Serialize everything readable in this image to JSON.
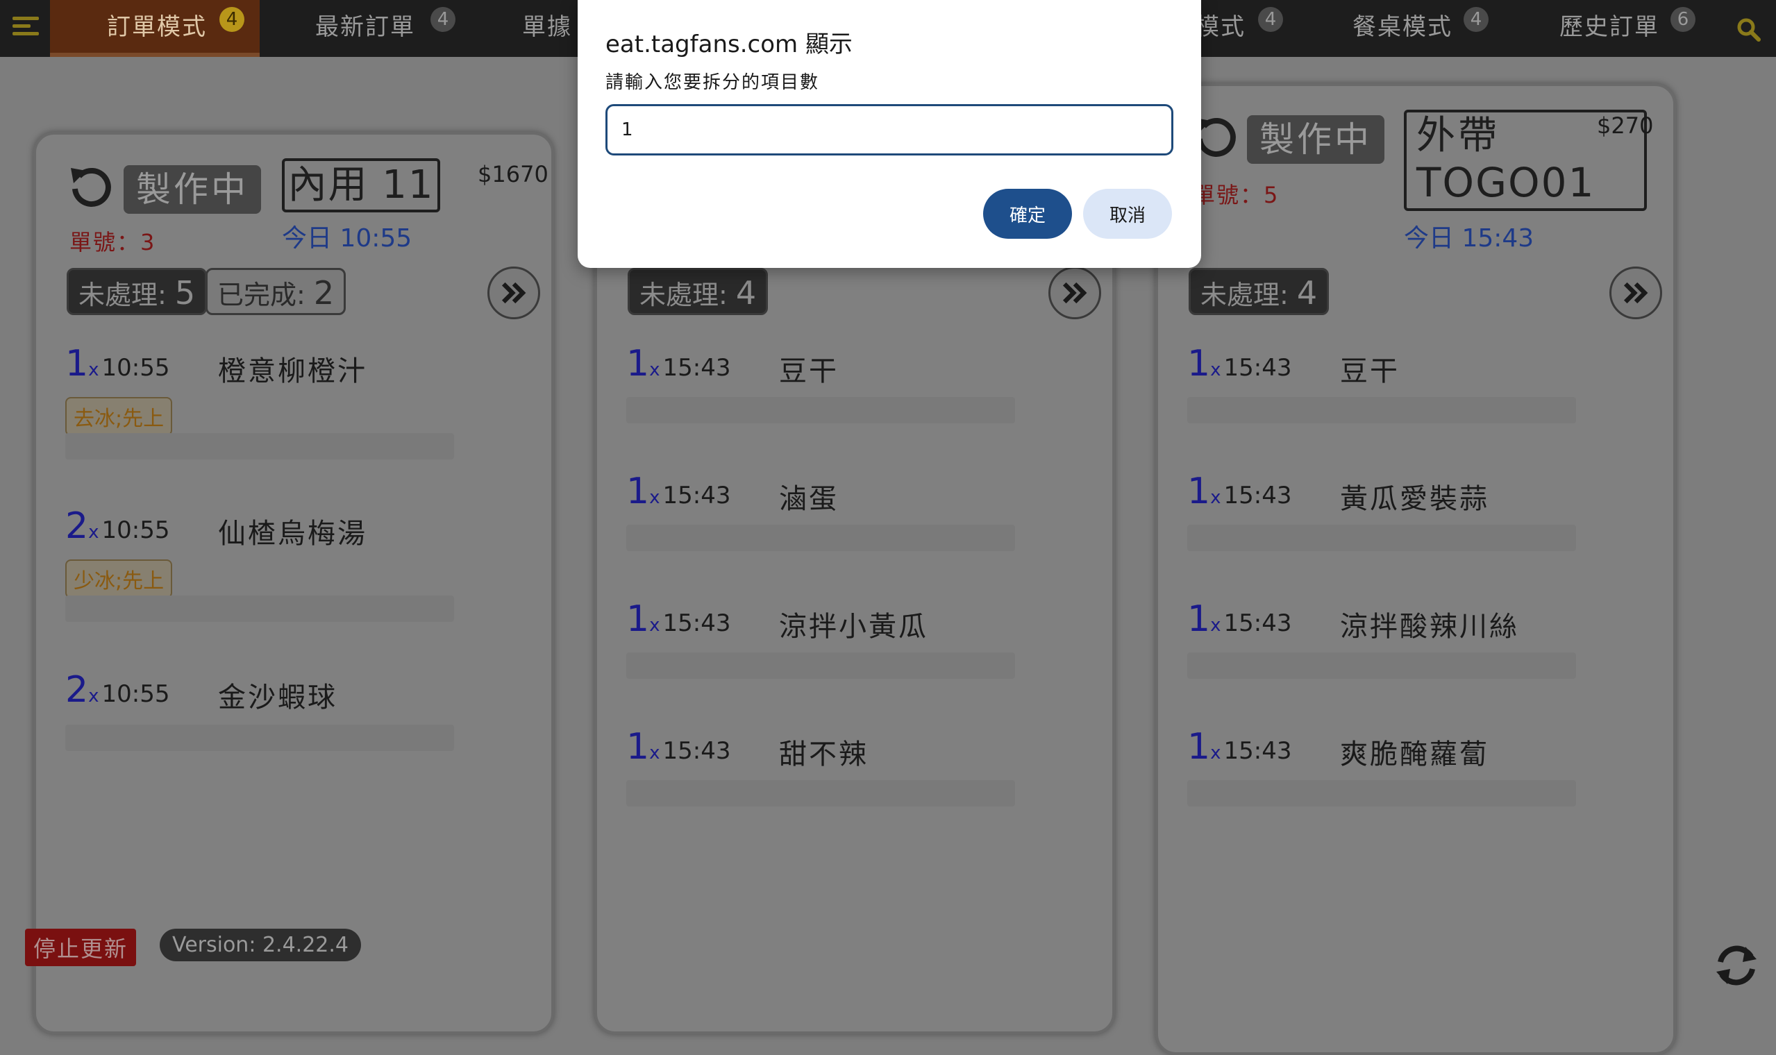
{
  "nav": {
    "tabs": [
      {
        "label": "訂單模式",
        "badge": "4"
      },
      {
        "label": "最新訂單",
        "badge": "4"
      },
      {
        "label": "單據",
        "badge": ""
      },
      {
        "label": "模式",
        "badge": "4"
      },
      {
        "label": "餐桌模式",
        "badge": "4"
      },
      {
        "label": "歷史訂單",
        "badge": "6"
      }
    ]
  },
  "cards": [
    {
      "status": "製作中",
      "table": "內用 11",
      "price": "$1670",
      "order_no": "單號：3",
      "time": "今日 10:55",
      "pending_label": "未處理:",
      "pending_count": "5",
      "done_label": "已完成:",
      "done_count": "2",
      "items": [
        {
          "qty": "1",
          "x": "x",
          "time": "10:55",
          "name": "橙意柳橙汁",
          "note": "去冰;先上"
        },
        {
          "qty": "2",
          "x": "x",
          "time": "10:55",
          "name": "仙楂烏梅湯",
          "note": "少冰;先上"
        },
        {
          "qty": "2",
          "x": "x",
          "time": "10:55",
          "name": "金沙蝦球",
          "note": ""
        }
      ]
    },
    {
      "pending_label": "未處理:",
      "pending_count": "4",
      "items": [
        {
          "qty": "1",
          "x": "x",
          "time": "15:43",
          "name": "豆干"
        },
        {
          "qty": "1",
          "x": "x",
          "time": "15:43",
          "name": "滷蛋"
        },
        {
          "qty": "1",
          "x": "x",
          "time": "15:43",
          "name": "涼拌小黃瓜"
        },
        {
          "qty": "1",
          "x": "x",
          "time": "15:43",
          "name": "甜不辣"
        }
      ]
    },
    {
      "status": "製作中",
      "table_line1": "外帶",
      "table_line2": "TOGO01",
      "price": "$270",
      "order_no": "單號：5",
      "time": "今日 15:43",
      "pending_label": "未處理:",
      "pending_count": "4",
      "items": [
        {
          "qty": "1",
          "x": "x",
          "time": "15:43",
          "name": "豆干"
        },
        {
          "qty": "1",
          "x": "x",
          "time": "15:43",
          "name": "黃瓜愛裝蒜"
        },
        {
          "qty": "1",
          "x": "x",
          "time": "15:43",
          "name": "涼拌酸辣川絲"
        },
        {
          "qty": "1",
          "x": "x",
          "time": "15:43",
          "name": "爽脆醃蘿蔔"
        }
      ]
    }
  ],
  "footer": {
    "stop_label": "停止更新",
    "version": "Version: 2.4.22.4"
  },
  "dialog": {
    "title": "eat.tagfans.com 顯示",
    "message": "請輸入您要拆分的項目數",
    "input_value": "1",
    "ok_label": "確定",
    "cancel_label": "取消"
  },
  "colors": {
    "accent_tab": "#5a2a10",
    "badge_active": "#b8961a",
    "ok_button": "#1e4f8c",
    "stop_button": "#7a1010"
  }
}
